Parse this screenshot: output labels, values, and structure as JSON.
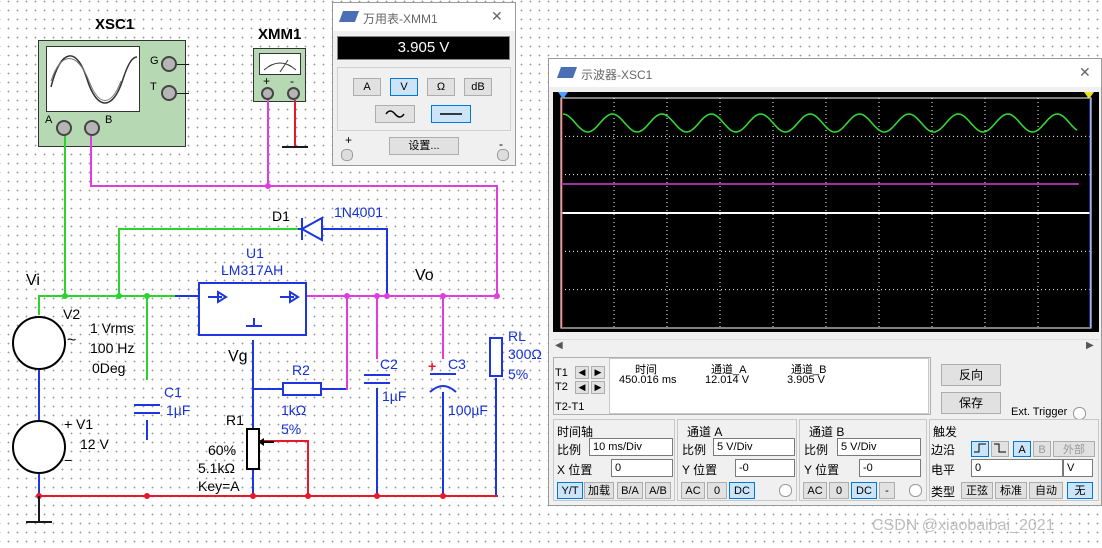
{
  "schematic": {
    "xsc1_label": "XSC1",
    "xsc1_terminals": {
      "g": "G",
      "t": "T",
      "a": "A",
      "b": "B"
    },
    "xmm1_label": "XMM1",
    "xmm1_terminals": {
      "plus": "+",
      "minus": "-"
    },
    "d1_ref": "D1",
    "d1_value": "1N4001",
    "u1_ref": "U1",
    "u1_value": "LM317AH",
    "vi_label": "Vi",
    "vo_label": "Vo",
    "vg_label": "Vg",
    "v2_ref": "V2",
    "v2_amp": "1 Vrms",
    "v2_freq": "100 Hz",
    "v2_phase": "0Deg",
    "v1_ref": "V1",
    "v1_value": "12 V",
    "v1_plus": "+",
    "v1_minus": "−",
    "c1_ref": "C1",
    "c1_value": "1µF",
    "r2_ref": "R2",
    "r2_value": "1kΩ",
    "r2_tol": "5%",
    "r1_ref": "R1",
    "r1_pct": "60%",
    "r1_value": "5.1kΩ",
    "r1_key": "Key=A",
    "c2_ref": "C2",
    "c2_value": "1µF",
    "c3_ref": "C3",
    "c3_value": "100µF",
    "c3_plus": "+",
    "rl_ref": "RL",
    "rl_value": "300Ω",
    "rl_tol": "5%"
  },
  "multimeter": {
    "title": "万用表-XMM1",
    "reading": "3.905 V",
    "buttons": [
      "A",
      "V",
      "Ω",
      "dB"
    ],
    "active_button": "V",
    "mode_active": "dc",
    "settings_label": "设置...",
    "plus_label": "+",
    "minus_label": "-",
    "close_glyph": "✕"
  },
  "oscilloscope": {
    "title": "示波器-XSC1",
    "close_glyph": "✕",
    "t1_label": "T1",
    "t2_label": "T2",
    "t2t1_label": "T2-T1",
    "readout_headers": {
      "time": "时间",
      "ch_a": "通道_A",
      "ch_b": "通道_B"
    },
    "readout_values": {
      "time": "450.016 ms",
      "ch_a": "12.014 V",
      "ch_b": "3.905 V"
    },
    "reverse_button": "反向",
    "save_button": "保存",
    "ext_trigger_label": "Ext. Trigger",
    "timebase": {
      "section_label": "时间轴",
      "scale_label": "比例",
      "scale_value": "10 ms/Div",
      "xpos_label": "X 位置",
      "xpos_value": "0",
      "modes": [
        "Y/T",
        "加载",
        "B/A",
        "A/B"
      ],
      "active_mode": "Y/T"
    },
    "channel_a": {
      "section_label": "通道 A",
      "scale_label": "比例",
      "scale_value": "5 V/Div",
      "ypos_label": "Y 位置",
      "ypos_value": "-0",
      "coupling": [
        "AC",
        "0",
        "DC"
      ],
      "active_coupling": "DC"
    },
    "channel_b": {
      "section_label": "通道 B",
      "scale_label": "比例",
      "scale_value": "5 V/Div",
      "ypos_label": "Y 位置",
      "ypos_value": "-0",
      "coupling": [
        "AC",
        "0",
        "DC",
        "-"
      ],
      "active_coupling": "DC"
    },
    "trigger": {
      "section_label": "触发",
      "edge_label": "边沿",
      "edge_buttons": [
        "⨍",
        "⨍",
        "A",
        "B",
        "外部"
      ],
      "level_label": "电平",
      "level_value": "0",
      "level_unit": "V",
      "type_label": "类型",
      "type_buttons": [
        "正弦",
        "标准",
        "自动",
        "无"
      ],
      "active_type": "无"
    },
    "traces": {
      "channel_a_color": "#35d435",
      "channel_b_color": "#d63fd6",
      "grid_color": "#ffffff",
      "background": "#000000"
    }
  },
  "watermark": "CSDN @xiaobaibai_2021"
}
